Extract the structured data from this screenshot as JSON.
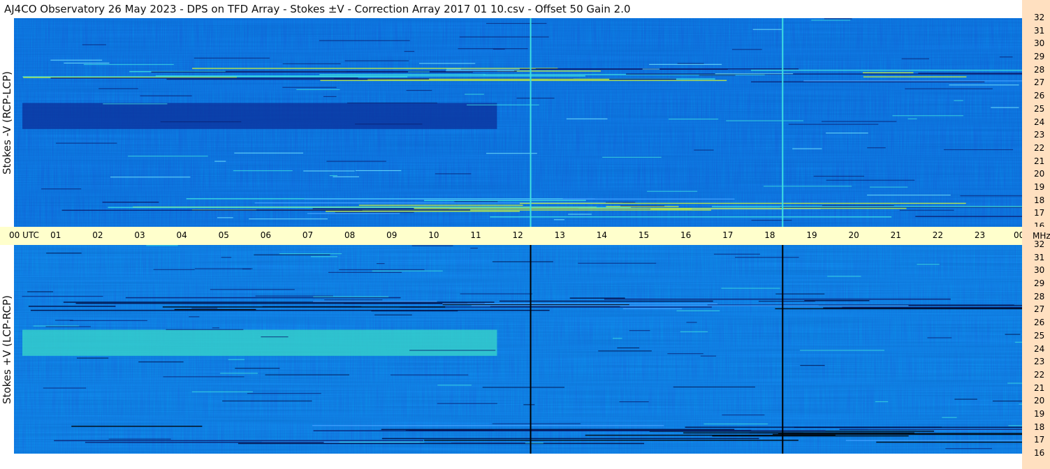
{
  "title": "AJ4CO Observatory  26 May 2023  -  DPS on TFD Array  -  Stokes ±V  -  Correction Array 2017 01 10.csv  -  Offset 50  Gain 2.0",
  "panels": {
    "top": {
      "ylabel": "Stokes -V (RCP-LCP)"
    },
    "bottom": {
      "ylabel": "Stokes +V (LCP-RCP)"
    }
  },
  "time_axis": {
    "first_label": "00 UTC",
    "labels": [
      "01",
      "02",
      "03",
      "04",
      "05",
      "06",
      "07",
      "08",
      "09",
      "10",
      "11",
      "12",
      "13",
      "14",
      "15",
      "16",
      "17",
      "18",
      "19",
      "20",
      "21",
      "22",
      "23"
    ],
    "last_label": "00",
    "unit": "MHz"
  },
  "freq_ticks": [
    "32",
    "31",
    "30",
    "29",
    "28",
    "27",
    "26",
    "25",
    "24",
    "23",
    "22",
    "21",
    "20",
    "19",
    "18",
    "17",
    "16"
  ],
  "colors": {
    "title_bg": "#ffffff",
    "time_axis_bg": "#ffffcc",
    "freq_axis_bg": "#ffe0c0",
    "background_blue": "#1a6fe6",
    "dark_blue": "#0a2a90",
    "bright_cyan": "#3fe0e0",
    "yellow_green": "#c8f040"
  },
  "chart_data": {
    "type": "heatmap",
    "description_axes": {
      "x": "UTC time (hours)",
      "y": "Frequency (MHz)"
    },
    "xlim": [
      0,
      24
    ],
    "ylim": [
      16,
      32
    ],
    "panels": [
      {
        "name": "Stokes -V (RCP-LCP)",
        "features": [
          {
            "kind": "vertical_line",
            "x": 12.3,
            "color": "cyan"
          },
          {
            "kind": "vertical_line",
            "x": 18.3,
            "color": "cyan"
          },
          {
            "kind": "dark_band",
            "x0": 0.2,
            "x1": 11.5,
            "y0": 23.5,
            "y1": 25.5
          },
          {
            "kind": "noise_band",
            "y0": 16.8,
            "y1": 18.2
          },
          {
            "kind": "noise_band",
            "y0": 27.0,
            "y1": 28.2
          }
        ]
      },
      {
        "name": "Stokes +V (LCP-RCP)",
        "features": [
          {
            "kind": "vertical_line",
            "x": 12.3,
            "color": "black"
          },
          {
            "kind": "vertical_line",
            "x": 18.3,
            "color": "black"
          },
          {
            "kind": "bright_band",
            "x0": 0.2,
            "x1": 11.5,
            "y0": 23.5,
            "y1": 25.5
          },
          {
            "kind": "dark_noise_band",
            "y0": 16.8,
            "y1": 18.2
          },
          {
            "kind": "dark_noise_band",
            "y0": 27.0,
            "y1": 28.0
          }
        ]
      }
    ]
  }
}
